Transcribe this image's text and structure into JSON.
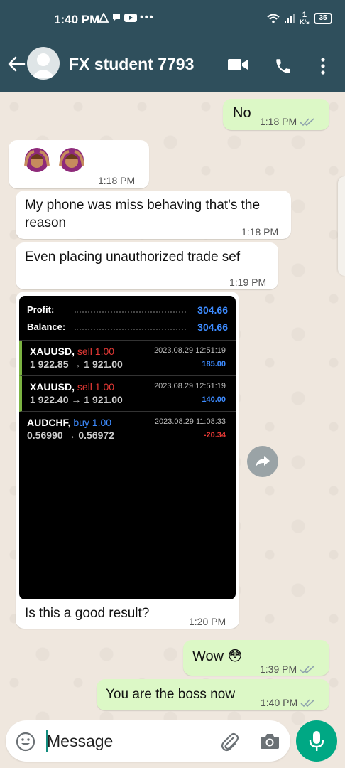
{
  "status_bar": {
    "time": "1:40 PM",
    "net_speed": "1",
    "net_unit": "K/s",
    "battery": "35"
  },
  "header": {
    "contact_name": "FX student 7793",
    "icons": [
      "back-arrow-icon",
      "video-call-icon",
      "phone-icon",
      "more-vert-icon"
    ]
  },
  "messages": [
    {
      "dir": "out",
      "text": "No",
      "time": "1:18 PM",
      "read": true
    },
    {
      "dir": "in",
      "text": "🙆🏽‍♀️🙆🏽‍♀️",
      "time": "1:18 PM"
    },
    {
      "dir": "in",
      "text": "My phone was miss behaving that's the reason",
      "time": "1:18 PM"
    },
    {
      "dir": "in",
      "text": "Even placing unauthorized trade sef",
      "time": "1:19 PM"
    },
    {
      "dir": "in",
      "text": "Is this a good result?",
      "time": "1:20 PM",
      "has_image": true
    },
    {
      "dir": "out",
      "text": "Wow 😳",
      "time": "1:39 PM",
      "read": true
    },
    {
      "dir": "out",
      "text": "You are the boss now",
      "time": "1:40 PM",
      "read": true
    }
  ],
  "trade_screenshot": {
    "profit_label": "Profit:",
    "profit_value": "304.66",
    "balance_label": "Balance:",
    "balance_value": "304.66",
    "trades": [
      {
        "symbol": "XAUUSD,",
        "side": "sell 1.00",
        "side_color": "#e53935",
        "prices": "1 922.85 → 1 921.00",
        "date": "2023.08.29 12:51:19",
        "pl": "185.00",
        "pl_color": "#3d8bff",
        "highlight": true
      },
      {
        "symbol": "XAUUSD,",
        "side": "sell 1.00",
        "side_color": "#e53935",
        "prices": "1 922.40 → 1 921.00",
        "date": "2023.08.29 12:51:19",
        "pl": "140.00",
        "pl_color": "#3d8bff",
        "highlight": true
      },
      {
        "symbol": "AUDCHF,",
        "side": "buy 1.00",
        "side_color": "#3d8bff",
        "prices": "0.56990 → 0.56972",
        "date": "2023.08.29 11:08:33",
        "pl": "-20.34",
        "pl_color": "#e53935",
        "highlight": false
      }
    ]
  },
  "composer": {
    "placeholder": "Message",
    "icons": [
      "emoji-icon",
      "attach-icon",
      "camera-icon",
      "mic-icon"
    ]
  },
  "colors": {
    "header_bg": "#2f4f5c",
    "outgoing_bubble": "#dcf8c6",
    "incoming_bubble": "#ffffff",
    "read_ticks": "#34b7f1",
    "accent_green": "#00a884"
  }
}
